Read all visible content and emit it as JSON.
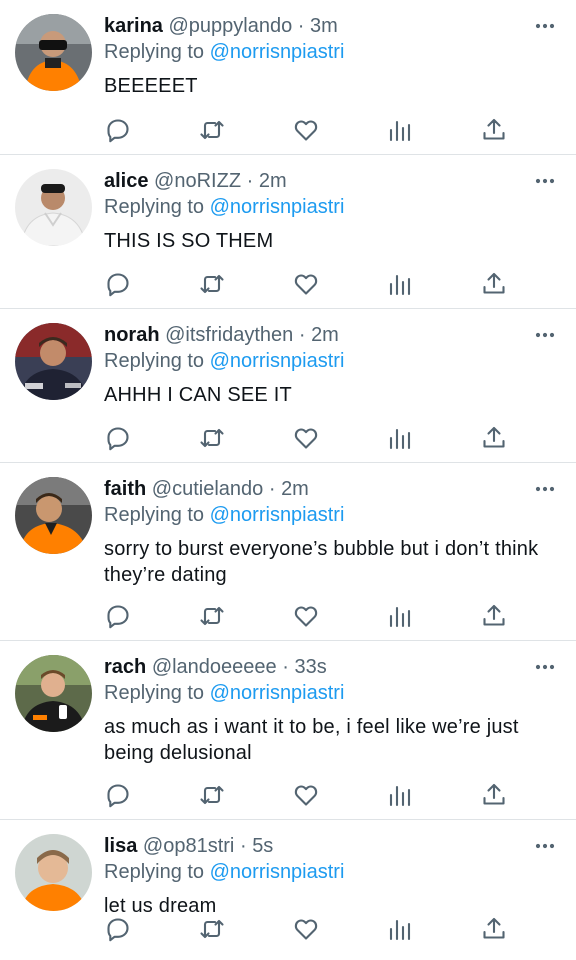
{
  "tweets": [
    {
      "name": "karina",
      "handle": "@puppylando",
      "separator": "·",
      "time": "3m",
      "reply_prefix": "Replying to",
      "reply_to": "@norrisnpiastri",
      "text": "BEEEEET",
      "avatar": "avatar-karina"
    },
    {
      "name": "alice",
      "handle": "@noRIZZ",
      "separator": "·",
      "time": "2m",
      "reply_prefix": "Replying to",
      "reply_to": "@norrisnpiastri",
      "text": "THIS IS SO THEM",
      "avatar": "avatar-alice"
    },
    {
      "name": "norah",
      "handle": "@itsfridaythen",
      "separator": "·",
      "time": "2m",
      "reply_prefix": "Replying to",
      "reply_to": "@norrisnpiastri",
      "text": "AHHH I CAN SEE IT",
      "avatar": "avatar-norah"
    },
    {
      "name": "faith",
      "handle": "@cutielando",
      "separator": "·",
      "time": "2m",
      "reply_prefix": "Replying to",
      "reply_to": "@norrisnpiastri",
      "text": "sorry to burst everyone’s bubble but i don’t think they’re dating",
      "avatar": "avatar-faith"
    },
    {
      "name": "rach",
      "handle": "@landoeeeee",
      "separator": "·",
      "time": "33s",
      "reply_prefix": "Replying to",
      "reply_to": "@norrisnpiastri",
      "text": "as much as i want it to be, i feel like we’re just being delusional",
      "avatar": "avatar-rach"
    },
    {
      "name": "lisa",
      "handle": "@op81stri",
      "separator": "·",
      "time": "5s",
      "reply_prefix": "Replying to",
      "reply_to": "@norrisnpiastri",
      "text": "let us dream",
      "avatar": "avatar-lisa"
    }
  ],
  "icons": [
    "more-icon",
    "reply-icon",
    "retweet-icon",
    "like-icon",
    "analytics-icon",
    "share-icon"
  ],
  "colors": {
    "text": "#0f1419",
    "secondary": "#536471",
    "link": "#1d9bf0",
    "divider": "#dfe3e6",
    "orange": "#ff8000"
  }
}
